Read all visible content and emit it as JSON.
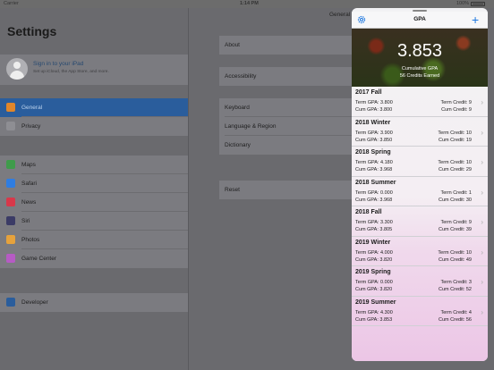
{
  "status_bar": {
    "carrier": "Carrier",
    "time": "1:14 PM",
    "battery": "100%"
  },
  "settings": {
    "title": "Settings",
    "profile": {
      "name": "Sign in to your iPad",
      "subtitle": "Set up iCloud, the App Store, and more."
    },
    "nav_title": "General",
    "sidebar_groups": [
      [
        {
          "label": "General",
          "icon": "gear-icon",
          "color": "#e0862a",
          "selected": true
        },
        {
          "label": "Privacy",
          "icon": "hand-icon",
          "color": "#8e8e93"
        }
      ],
      [
        {
          "label": "Maps",
          "icon": "map-icon",
          "color": "#3f9b4b"
        },
        {
          "label": "Safari",
          "icon": "compass-icon",
          "color": "#2f7de1"
        },
        {
          "label": "News",
          "icon": "news-icon",
          "color": "#d8384a"
        },
        {
          "label": "Siri",
          "icon": "siri-icon",
          "color": "#3b3b66"
        },
        {
          "label": "Photos",
          "icon": "photos-icon",
          "color": "#e6a23c"
        },
        {
          "label": "Game Center",
          "icon": "game-center-icon",
          "color": "#b65bc4"
        }
      ],
      [
        {
          "label": "Developer",
          "icon": "hammer-icon",
          "color": "#2a5d9c"
        }
      ]
    ],
    "detail_groups": [
      [
        "About"
      ],
      [
        "Accessibility"
      ],
      [
        "Keyboard",
        "Language & Region",
        "Dictionary"
      ],
      [
        "Reset"
      ]
    ]
  },
  "gpa_app": {
    "title": "GPA",
    "cumulative_gpa": "3.853",
    "cumulative_label": "Cumulative GPA",
    "credits_label": "56 Credits Earned",
    "terms": [
      {
        "name": "2017 Fall",
        "term_gpa": "Term GPA: 3.800",
        "cum_gpa": "Cum GPA: 3.800",
        "term_credit": "Term Credit: 9",
        "cum_credit": "Cum Credit: 9"
      },
      {
        "name": "2018 Winter",
        "term_gpa": "Term GPA: 3.900",
        "cum_gpa": "Cum GPA: 3.850",
        "term_credit": "Term Credit: 10",
        "cum_credit": "Cum Credit: 19"
      },
      {
        "name": "2018 Spring",
        "term_gpa": "Term GPA: 4.180",
        "cum_gpa": "Cum GPA: 3.968",
        "term_credit": "Term Credit: 10",
        "cum_credit": "Cum Credit: 29"
      },
      {
        "name": "2018 Summer",
        "term_gpa": "Term GPA: 0.000",
        "cum_gpa": "Cum GPA: 3.968",
        "term_credit": "Term Credit: 1",
        "cum_credit": "Cum Credit: 30"
      },
      {
        "name": "2018 Fall",
        "term_gpa": "Term GPA: 3.300",
        "cum_gpa": "Cum GPA: 3.805",
        "term_credit": "Term Credit: 9",
        "cum_credit": "Cum Credit: 39"
      },
      {
        "name": "2019 Winter",
        "term_gpa": "Term GPA: 4.000",
        "cum_gpa": "Cum GPA: 3.820",
        "term_credit": "Term Credit: 10",
        "cum_credit": "Cum Credit: 49"
      },
      {
        "name": "2019 Spring",
        "term_gpa": "Term GPA: 0.000",
        "cum_gpa": "Cum GPA: 3.820",
        "term_credit": "Term Credit: 3",
        "cum_credit": "Cum Credit: 52"
      },
      {
        "name": "2019 Summer",
        "term_gpa": "Term GPA: 4.300",
        "cum_gpa": "Cum GPA: 3.853",
        "term_credit": "Term Credit: 4",
        "cum_credit": "Cum Credit: 56"
      }
    ]
  }
}
